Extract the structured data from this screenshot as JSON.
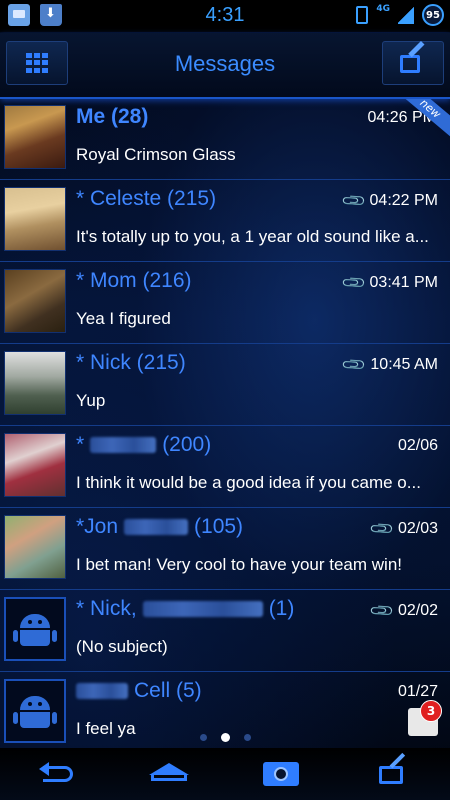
{
  "status_bar": {
    "time": "4:31",
    "network": "4G",
    "battery": "95",
    "icons": [
      "message-notification-icon",
      "store-download-icon",
      "vibrate-icon",
      "signal-icon",
      "battery-icon"
    ]
  },
  "header": {
    "title": "Messages",
    "left_icon": "app-grid-icon",
    "right_icon": "compose-icon"
  },
  "colors": {
    "accent": "#3f86ff",
    "divider": "#143c8a",
    "badge": "#e02020"
  },
  "conversations": [
    {
      "name": "Me (28)",
      "unread_marker": "",
      "has_attachment": false,
      "time": "04:26 PM",
      "snippet": "Royal Crimson Glass",
      "is_new": true,
      "new_label": "new",
      "avatar": "photo"
    },
    {
      "name": "* Celeste (215)",
      "has_attachment": true,
      "time": "04:22 PM",
      "snippet": "It's totally up to you, a 1 year old sound like a...",
      "avatar": "photo"
    },
    {
      "name": "* Mom (216)",
      "has_attachment": true,
      "time": "03:41 PM",
      "snippet": "Yea I figured",
      "avatar": "photo"
    },
    {
      "name": "* Nick (215)",
      "has_attachment": true,
      "time": "10:45 AM",
      "snippet": "Yup",
      "avatar": "photo"
    },
    {
      "name_prefix": "*",
      "name_suffix": "(200)",
      "has_attachment": false,
      "time": "02/06",
      "snippet": "I think it would be a good idea if you came o...",
      "avatar": "photo"
    },
    {
      "name_prefix": "*Jon",
      "name_suffix": "(105)",
      "has_attachment": true,
      "time": "02/03",
      "snippet": "I bet man! Very cool to have your team win!",
      "avatar": "photo"
    },
    {
      "name_prefix": "* Nick,",
      "name_suffix": "(1)",
      "has_attachment": true,
      "time": "02/02",
      "snippet": "(No subject)",
      "avatar": "android"
    },
    {
      "name_prefix": "",
      "name_suffix": "Cell (5)",
      "has_attachment": false,
      "time": "01/27",
      "snippet": "I feel ya",
      "avatar": "android"
    }
  ],
  "notification": {
    "count": "3"
  },
  "pager": {
    "pages": 3,
    "active": 1
  },
  "nav": {
    "back_icon": "back-icon",
    "home_icon": "home-icon",
    "camera_icon": "screenshot-icon",
    "compose_icon": "compose-icon"
  }
}
